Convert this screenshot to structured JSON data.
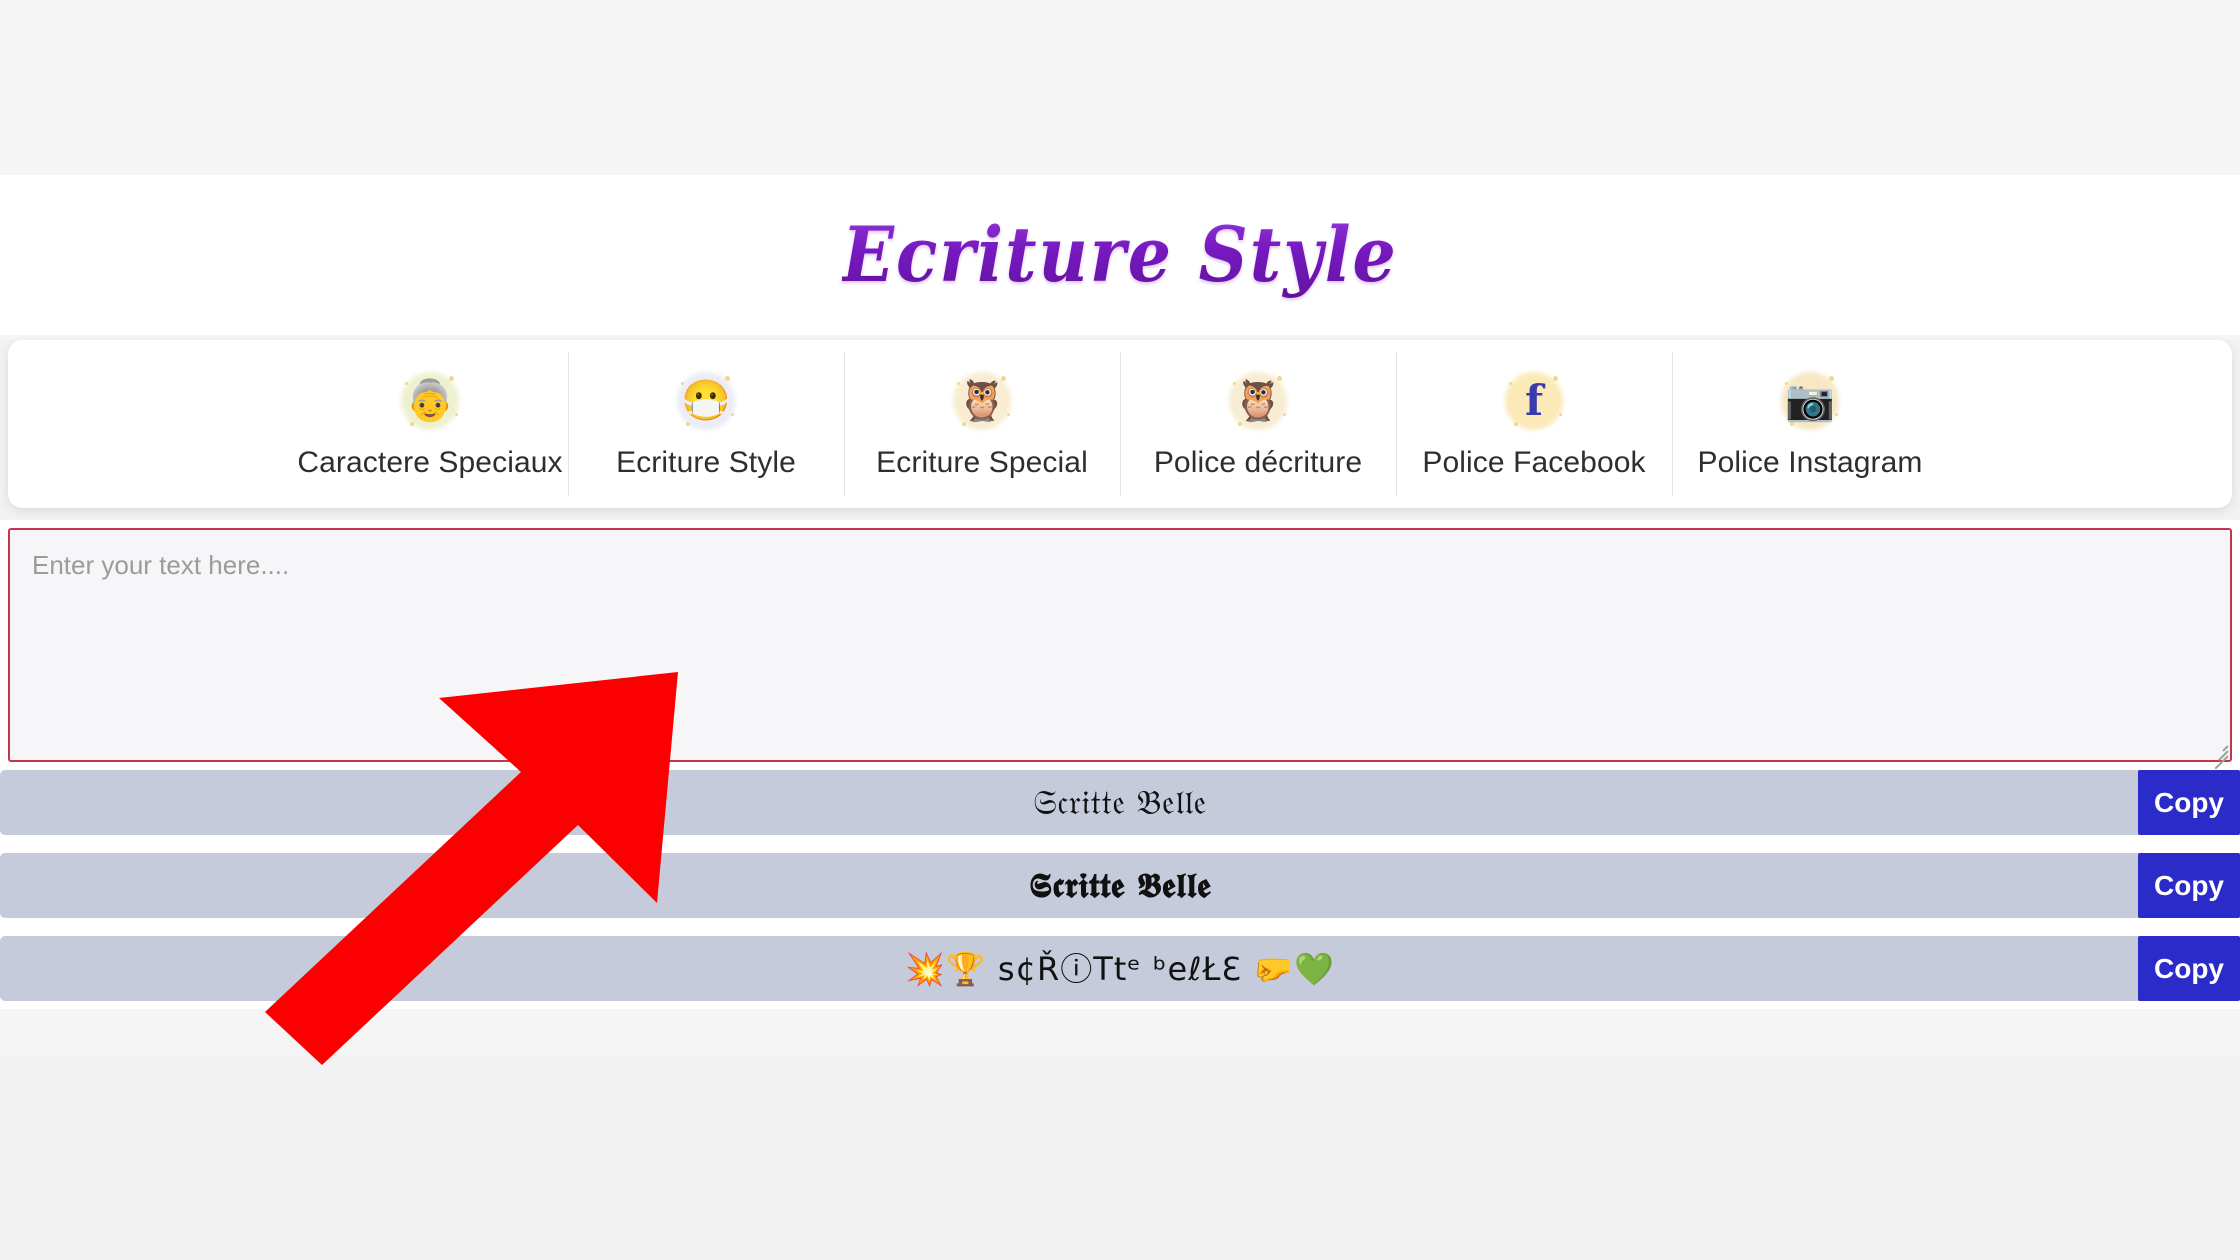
{
  "header": {
    "site_title": "Ecriture Style"
  },
  "nav": {
    "items": [
      {
        "label": "Caractere Speciaux",
        "icon": "older-woman-icon",
        "emoji": "👵",
        "glow": "#eef1cf"
      },
      {
        "label": "Ecriture Style",
        "icon": "stormtrooper-face-icon",
        "emoji": "😷",
        "glow": "#ecebf6"
      },
      {
        "label": "Ecriture Special",
        "icon": "green-owl-icon",
        "emoji": "🦉",
        "glow": "#f8ecd2"
      },
      {
        "label": "Police décriture",
        "icon": "green-owl-icon",
        "emoji": "🦉",
        "glow": "#f8ecd2"
      },
      {
        "label": "Police Facebook",
        "icon": "facebook-icon",
        "emoji": "f",
        "glow": "#fbe9b8"
      },
      {
        "label": "Police Instagram",
        "icon": "instagram-camera-icon",
        "emoji": "📷",
        "glow": "#f7e7c4"
      }
    ]
  },
  "editor": {
    "placeholder": "Enter your text here....",
    "value": ""
  },
  "results": {
    "copy_label": "Copy",
    "rows": [
      {
        "text": "𝔖𝔠𝔯𝔦𝔱𝔱𝔢 𝔅𝔢𝔩𝔩𝔢",
        "style": "fraktur"
      },
      {
        "text": "𝕾𝖈𝖗𝖎𝖙𝖙𝖊 𝕭𝖊𝖑𝖑𝖊",
        "style": "fraktur-bold"
      },
      {
        "text": "💥🏆 s¢ŘⓘTtᵉ ᵇeℓŁƐ 🤛💚",
        "style": "mixed"
      }
    ]
  },
  "annotation": {
    "arrow_color": "#fa0000",
    "arrow_direction": "up-right"
  },
  "colors": {
    "page_background": "#f5f5f5",
    "card_background": "#ffffff",
    "row_background": "#c5cbdb",
    "copy_button": "#2b2bc9",
    "title_purple": "#7615c0",
    "textarea_border": "#c2354b"
  }
}
